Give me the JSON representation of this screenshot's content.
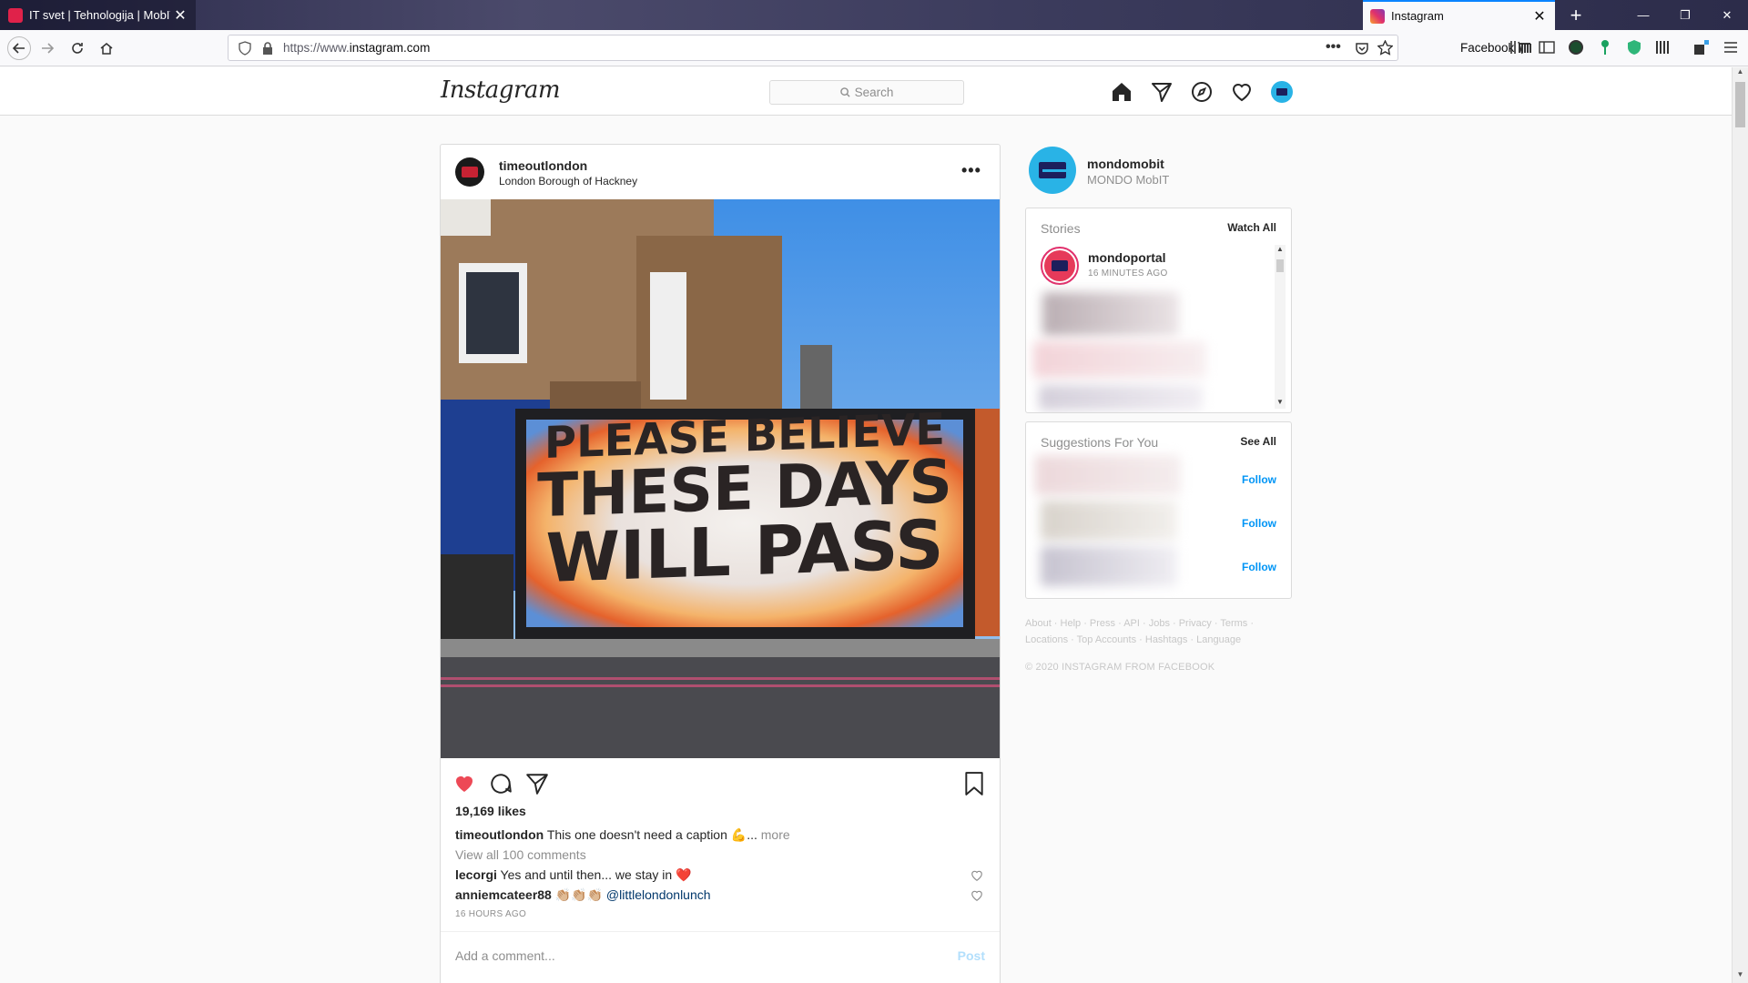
{
  "browser": {
    "tabs": [
      {
        "title": "IT svet | Tehnologija | MobIT",
        "active": false
      },
      {
        "title": "Instagram",
        "active": true
      }
    ],
    "url_prefix": "https://www.",
    "url_domain": "instagram.com",
    "container_label": "Facebook"
  },
  "instagram": {
    "logo": "Instagram",
    "search_placeholder": "Search"
  },
  "post": {
    "username": "timeoutlondon",
    "location": "London Borough of Hackney",
    "billboard_lines": [
      "PLEASE BELIEVE",
      "THESE DAYS",
      "WILL PASS"
    ],
    "likes": "19,169 likes",
    "caption_user": "timeoutlondon",
    "caption_text": "This one doesn't need a caption 💪...",
    "caption_more": "more",
    "view_all_comments": "View all 100 comments",
    "comments": [
      {
        "user": "lecorgi",
        "text": "Yes and until then... we stay in ❤️",
        "mention": ""
      },
      {
        "user": "anniemcateer88",
        "text": "👏🏼👏🏼👏🏼",
        "mention": "@littlelondonlunch"
      }
    ],
    "time_ago": "16 HOURS AGO",
    "add_comment_placeholder": "Add a comment...",
    "post_button": "Post"
  },
  "sidebar": {
    "username": "mondomobit",
    "full_name": "MONDO MobIT",
    "stories_title": "Stories",
    "watch_all": "Watch All",
    "story_user": "mondoportal",
    "story_time": "16 MINUTES AGO",
    "suggestions_title": "Suggestions For You",
    "see_all": "See All",
    "follow_label": "Follow",
    "footer_line1": "About · Help · Press · API · Jobs · Privacy · Terms ·",
    "footer_line2": "Locations · Top Accounts · Hashtags · Language",
    "copyright": "© 2020 INSTAGRAM FROM FACEBOOK"
  },
  "colors": {
    "accent_blue": "#0095f6",
    "like_red": "#ed4956",
    "avatar_blue": "#29b3e6"
  }
}
